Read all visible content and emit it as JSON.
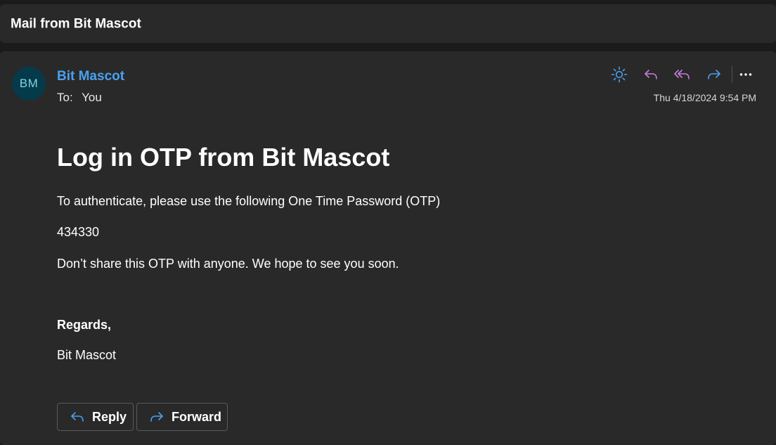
{
  "subject": "Mail from Bit Mascot",
  "sender": {
    "initials": "BM",
    "name": "Bit Mascot"
  },
  "recipients": {
    "label": "To:",
    "value": "You"
  },
  "timestamp": "Thu 4/18/2024 9:54 PM",
  "toolbar_icons": [
    "sun-icon",
    "reply-icon",
    "reply-all-icon",
    "forward-icon",
    "more-icon"
  ],
  "colors": {
    "accent_blue": "#4aa0f0",
    "reply_purple": "#c77dd9",
    "avatar_bg": "#053a4a",
    "avatar_text": "#7fd3e2"
  },
  "body": {
    "heading": "Log in OTP from Bit Mascot",
    "intro": "To authenticate, please use the following One Time Password (OTP)",
    "otp": "434330",
    "warning": "Don’t share this OTP with anyone. We hope to see you soon.",
    "regards": "Regards,",
    "signature": "Bit Mascot"
  },
  "footer": {
    "reply_label": "Reply",
    "forward_label": "Forward"
  }
}
